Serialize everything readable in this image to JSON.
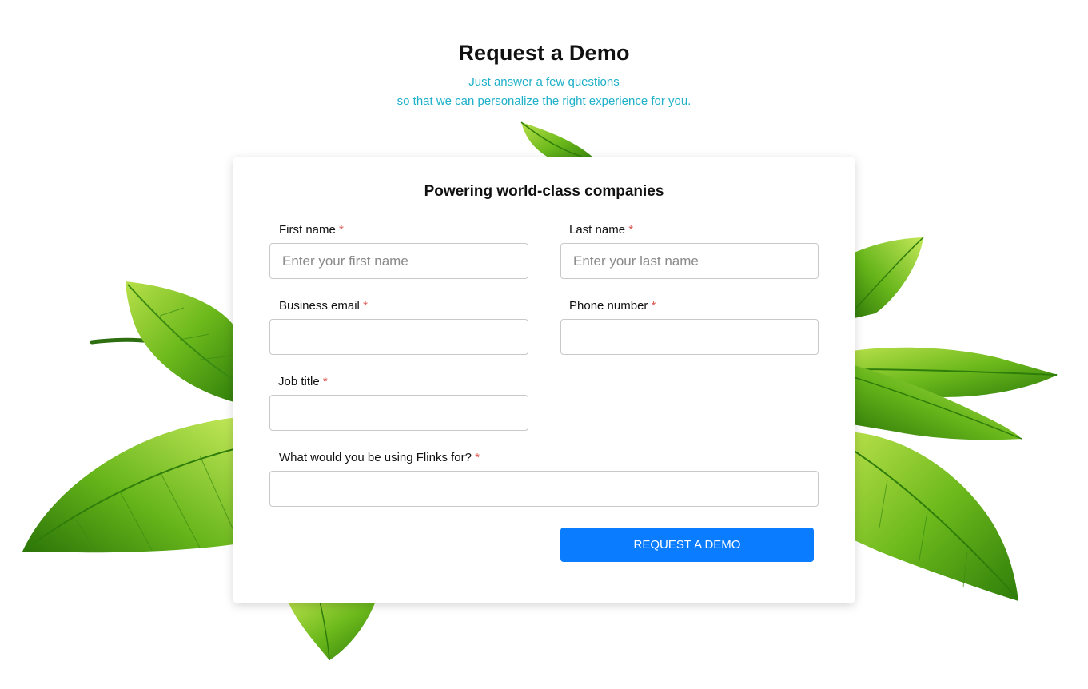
{
  "header": {
    "title": "Request a Demo",
    "subtitle_line1": "Just answer a few questions",
    "subtitle_line2": "so that we can personalize the right experience for you."
  },
  "form": {
    "title": "Powering world-class companies",
    "required_marker": "*",
    "fields": {
      "first_name": {
        "label": "First name",
        "placeholder": "Enter your first name",
        "value": ""
      },
      "last_name": {
        "label": "Last name",
        "placeholder": "Enter your last name",
        "value": ""
      },
      "business_email": {
        "label": "Business email",
        "placeholder": "",
        "value": ""
      },
      "phone_number": {
        "label": "Phone number",
        "placeholder": "",
        "value": ""
      },
      "job_title": {
        "label": "Job title",
        "placeholder": "",
        "value": ""
      },
      "usage": {
        "label": "What would you be using Flinks for?",
        "placeholder": "",
        "value": ""
      }
    },
    "submit_label": "REQUEST A DEMO"
  },
  "colors": {
    "subtitle": "#1fb0c9",
    "primary_button": "#0a7cff",
    "required": "#d9534f",
    "leaf_green": "#5aa814"
  },
  "background": {
    "image": "green-leaves-illustration"
  }
}
